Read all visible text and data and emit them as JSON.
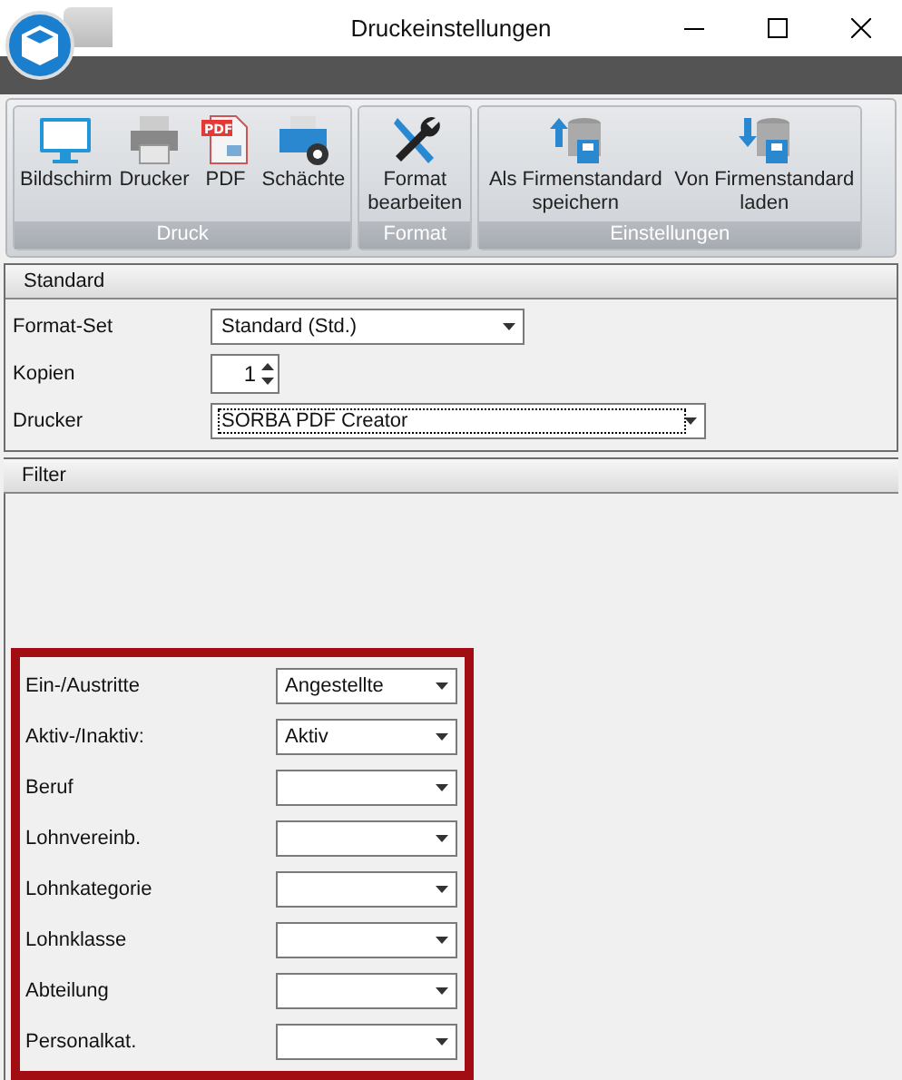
{
  "window": {
    "title": "Druckeinstellungen"
  },
  "ribbon": {
    "groups": [
      {
        "label": "Druck",
        "buttons": [
          {
            "kind": "monitor",
            "label": "Bildschirm"
          },
          {
            "kind": "printer",
            "label": "Drucker"
          },
          {
            "kind": "pdf",
            "label": "PDF",
            "badge": "PDF"
          },
          {
            "kind": "trays",
            "label": "Schächte"
          }
        ]
      },
      {
        "label": "Format",
        "buttons": [
          {
            "kind": "tools",
            "label": "Format bearbeiten"
          }
        ]
      },
      {
        "label": "Einstellungen",
        "buttons": [
          {
            "kind": "upload",
            "label": "Als Firmenstandard speichern"
          },
          {
            "kind": "download",
            "label": "Von Firmenstandard laden"
          }
        ]
      }
    ]
  },
  "standard": {
    "title": "Standard",
    "fields": [
      {
        "kind": "select",
        "label": "Format-Set",
        "value": "Standard (Std.)",
        "focused": false
      },
      {
        "kind": "spinner",
        "label": "Kopien",
        "value": "1"
      },
      {
        "kind": "select",
        "label": "Drucker",
        "value": "SORBA PDF Creator",
        "focused": true
      }
    ]
  },
  "filter": {
    "title": "Filter",
    "highlighted": true,
    "fields": [
      {
        "label": "Ein-/Austritte",
        "value": "Angestellte"
      },
      {
        "label": "Aktiv-/Inaktiv:",
        "value": "Aktiv"
      },
      {
        "label": "Beruf"
      },
      {
        "label": "Lohnvereinb."
      },
      {
        "label": "Lohnkategorie"
      },
      {
        "label": "Lohnklasse"
      },
      {
        "label": "Abteilung"
      },
      {
        "label": "Personalkat."
      }
    ]
  }
}
